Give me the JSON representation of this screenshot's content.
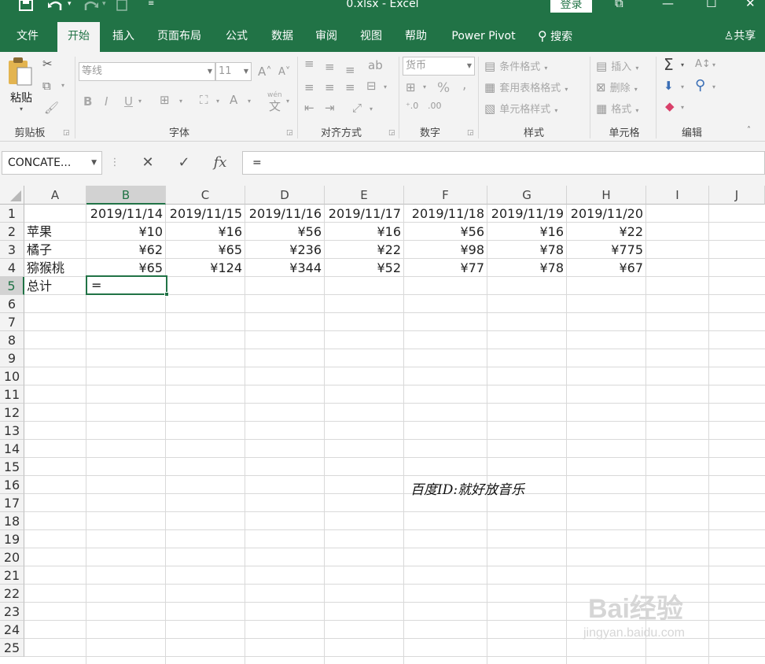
{
  "titlebar": {
    "title": "0.xlsx  -  Excel",
    "login": "登录",
    "save_icon": "save-icon",
    "undo_icon": "undo-icon",
    "redo_icon": "redo-icon"
  },
  "tabs": [
    "文件",
    "开始",
    "插入",
    "页面布局",
    "公式",
    "数据",
    "审阅",
    "视图",
    "帮助",
    "Power Pivot",
    "搜索"
  ],
  "share": "共享",
  "ribbon": {
    "paste": "粘贴",
    "clipboard": "剪贴板",
    "font_name": "等线",
    "font_size": "11",
    "font": "字体",
    "bold": "B",
    "italic": "I",
    "underline": "U",
    "align": "对齐方式",
    "number_format": "货币",
    "number": "数字",
    "percent": "%",
    "comma": ",",
    "cond_format": "条件格式",
    "table_format": "套用表格格式",
    "cell_style": "单元格样式",
    "styles": "样式",
    "insert": "插入",
    "delete": "删除",
    "format": "格式",
    "cells": "单元格",
    "editing": "编辑",
    "sum_sign": "Σ",
    "wen": "wén"
  },
  "formula_bar": {
    "name_box": "CONCATE...",
    "cancel": "✕",
    "enter": "✓",
    "fx": "fx",
    "formula": "="
  },
  "sheet": {
    "columns": [
      "A",
      "B",
      "C",
      "D",
      "E",
      "F",
      "G",
      "H",
      "I",
      "J"
    ],
    "rows": [
      "1",
      "2",
      "3",
      "4",
      "5",
      "6",
      "7",
      "8",
      "9",
      "10",
      "11",
      "12",
      "13",
      "14",
      "15",
      "16",
      "17",
      "18",
      "19",
      "20",
      "21",
      "22",
      "23",
      "24",
      "25"
    ],
    "dates": [
      "2019/11/14",
      "2019/11/15",
      "2019/11/16",
      "2019/11/17",
      "2019/11/18",
      "2019/11/19",
      "2019/11/20"
    ],
    "data_rows": [
      {
        "label": "苹果",
        "values": [
          "¥10",
          "¥16",
          "¥56",
          "¥16",
          "¥56",
          "¥16",
          "¥22"
        ]
      },
      {
        "label": "橘子",
        "values": [
          "¥62",
          "¥65",
          "¥236",
          "¥22",
          "¥98",
          "¥78",
          "¥775"
        ]
      },
      {
        "label": "猕猴桃",
        "values": [
          "¥65",
          "¥124",
          "¥344",
          "¥52",
          "¥77",
          "¥78",
          "¥67"
        ]
      }
    ],
    "total_label": "总计",
    "active_cell_value": "=",
    "note": "百度ID:就好放音乐"
  },
  "watermark": {
    "brand": "Bai经验",
    "url": "jingyan.baidu.com"
  },
  "colors": {
    "excel_green": "#217346"
  }
}
